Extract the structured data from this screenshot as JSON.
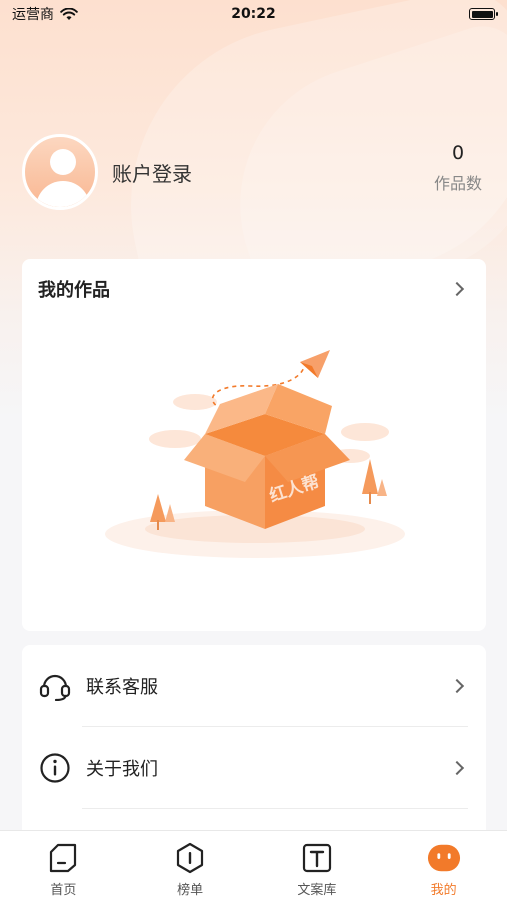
{
  "status_bar": {
    "carrier": "运营商",
    "time": "20:22"
  },
  "profile": {
    "login_label": "账户登录",
    "works_count": "0",
    "works_count_label": "作品数"
  },
  "my_works": {
    "title": "我的作品",
    "illustration_text": "红人帮"
  },
  "menu": {
    "items": [
      {
        "label": "联系客服",
        "icon": "headset-icon"
      },
      {
        "label": "关于我们",
        "icon": "info-icon"
      }
    ]
  },
  "tab_bar": {
    "active": "我的",
    "tabs": [
      {
        "label": "首页",
        "icon": "home-icon"
      },
      {
        "label": "榜单",
        "icon": "ranking-icon"
      },
      {
        "label": "文案库",
        "icon": "text-library-icon"
      },
      {
        "label": "我的",
        "icon": "profile-face-icon"
      }
    ]
  },
  "colors": {
    "accent": "#f27a2a",
    "hero_bg": "#fde0cf",
    "page_bg": "#f6f6f8"
  }
}
